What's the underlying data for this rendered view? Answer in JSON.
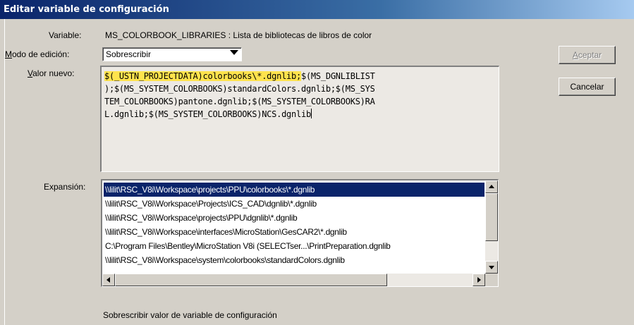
{
  "window": {
    "title": "Editar variable de configuración"
  },
  "labels": {
    "variable": "Variable:",
    "edit_mode_accel": "M",
    "edit_mode_rest": "odo de edición:",
    "new_value_accel": "V",
    "new_value_rest": "alor nuevo:",
    "expansion": "Expansión:"
  },
  "variable": {
    "name_desc": "MS_COLORBOOK_LIBRARIES : Lista de bibliotecas de libros de color"
  },
  "edit_mode": {
    "selected": "Sobrescribir"
  },
  "new_value": {
    "highlighted": "$(_USTN_PROJECTDATA)colorbooks\\*.dgnlib;",
    "line1_rest": "$(MS_DGNLIBLIST",
    "line2": ");$(MS_SYSTEM_COLORBOOKS)standardColors.dgnlib;$(MS_SYS",
    "line3": "TEM_COLORBOOKS)pantone.dgnlib;$(MS_SYSTEM_COLORBOOKS)RA",
    "line4": "L.dgnlib;$(MS_SYSTEM_COLORBOOKS)NCS.dgnlib"
  },
  "expansion_items": [
    "\\\\lilit\\RSC_V8i\\Workspace\\projects\\PPU\\colorbooks\\*.dgnlib",
    "\\\\lilit\\RSC_V8i\\Workspace\\Projects\\ICS_CAD\\dgnlib\\*.dgnlib",
    "\\\\lilit\\RSC_V8i\\Workspace\\projects\\PPU\\dgnlib\\*.dgnlib",
    "\\\\lilit\\RSC_V8i\\Workspace\\interfaces\\MicroStation\\GesCAR2\\*.dgnlib",
    "C:\\Program Files\\Bentley\\MicroStation V8i (SELECTser...\\PrintPreparation.dgnlib",
    "\\\\lilit\\RSC_V8i\\Workspace\\system\\colorbooks\\standardColors.dgnlib"
  ],
  "buttons": {
    "accept_accel": "A",
    "accept_rest": "ceptar",
    "cancel": "Cancelar"
  },
  "status": {
    "text": "Sobrescribir valor de variable de configuración"
  },
  "colors": {
    "highlight": "#ffe34d",
    "selection": "#0a246a",
    "titlebar": "#0a246a"
  }
}
